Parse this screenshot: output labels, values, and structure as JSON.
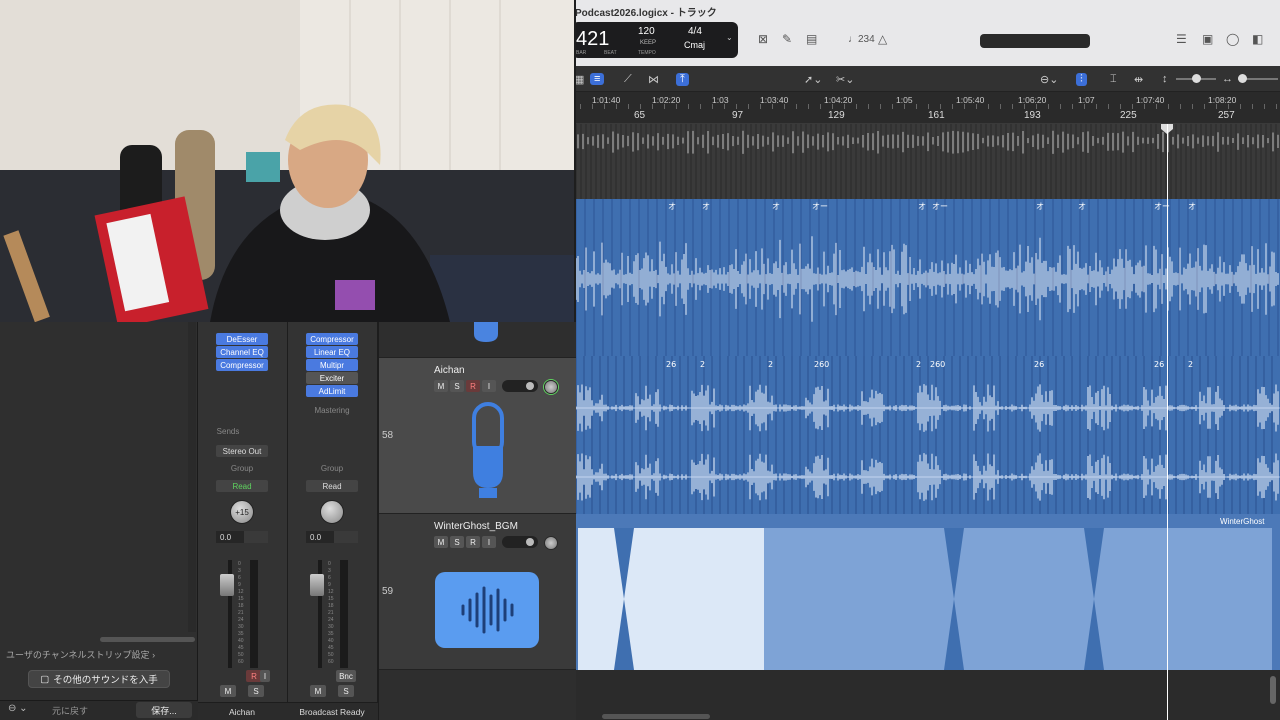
{
  "window": {
    "title": "Podcast2026.logicx - トラック"
  },
  "lcd": {
    "bar": "421",
    "bar_label": "BAR",
    "beat_label": "BEAT",
    "tempo": "120",
    "tempo_mode": "KEEP",
    "tempo_label": "TEMPO",
    "time_signature": "4/4",
    "key": "Cmaj"
  },
  "toolbar": {
    "count_in": "♩234"
  },
  "ruler": {
    "times": [
      "1:01:40",
      "1:02:20",
      "1:03",
      "1:03:40",
      "1:04:20",
      "1:05",
      "1:05:40",
      "1:06:20",
      "1:07",
      "1:07:40",
      "1:08:20"
    ],
    "bars": [
      "65",
      "97",
      "129",
      "161",
      "193",
      "225",
      "257"
    ]
  },
  "library": {
    "settings_link": "ユーザのチャンネルストリップ設定",
    "get_more_button": "その他のサウンドを入手",
    "revert_button": "元に戻す",
    "save_button": "保存..."
  },
  "strips": [
    {
      "name": "Aichan",
      "plugins": [
        "DeEsser",
        "Channel EQ",
        "Compressor"
      ],
      "sends_label": "Sends",
      "output": "Stereo Out",
      "group_label": "Group",
      "automation": "Read",
      "pan": "+15",
      "volume": "0.0",
      "mute": "M",
      "solo": "S",
      "rec": "R",
      "input": "I"
    },
    {
      "name": "Broadcast Ready",
      "plugins": [
        "Compressor",
        "Linear EQ",
        "Multipr",
        "Exciter",
        "AdLimit"
      ],
      "mastering_label": "Mastering",
      "group_label": "Group",
      "automation": "Read",
      "volume": "0.0",
      "bounce": "Bnc",
      "mute": "M",
      "solo": "S"
    }
  ],
  "meter_scale": [
    "0",
    "3",
    "6",
    "9",
    "12",
    "15",
    "18",
    "21",
    "24",
    "30",
    "35",
    "40",
    "45",
    "50",
    "60"
  ],
  "tracks": [
    {
      "number": "58",
      "name": "Aichan",
      "mute": "M",
      "solo": "S",
      "rec": "R",
      "input": "I",
      "markers": [
        "26",
        "2",
        "2",
        "260",
        "2",
        "260",
        "26",
        "26",
        "2"
      ]
    },
    {
      "number": "59",
      "name": "WinterGhost_BGM",
      "mute": "M",
      "solo": "S",
      "rec": "R",
      "input": "I",
      "region_label": "WinterGhost"
    }
  ],
  "upper_lane_markers": [
    "オ",
    "オ",
    "オ",
    "オー",
    "オ",
    "オー",
    "オ",
    "オ",
    "オー",
    "オ"
  ],
  "colors": {
    "region_blue": "#3f6fb0",
    "bgm_blue": "#7ea3d6",
    "accent": "#3c6fd8"
  }
}
